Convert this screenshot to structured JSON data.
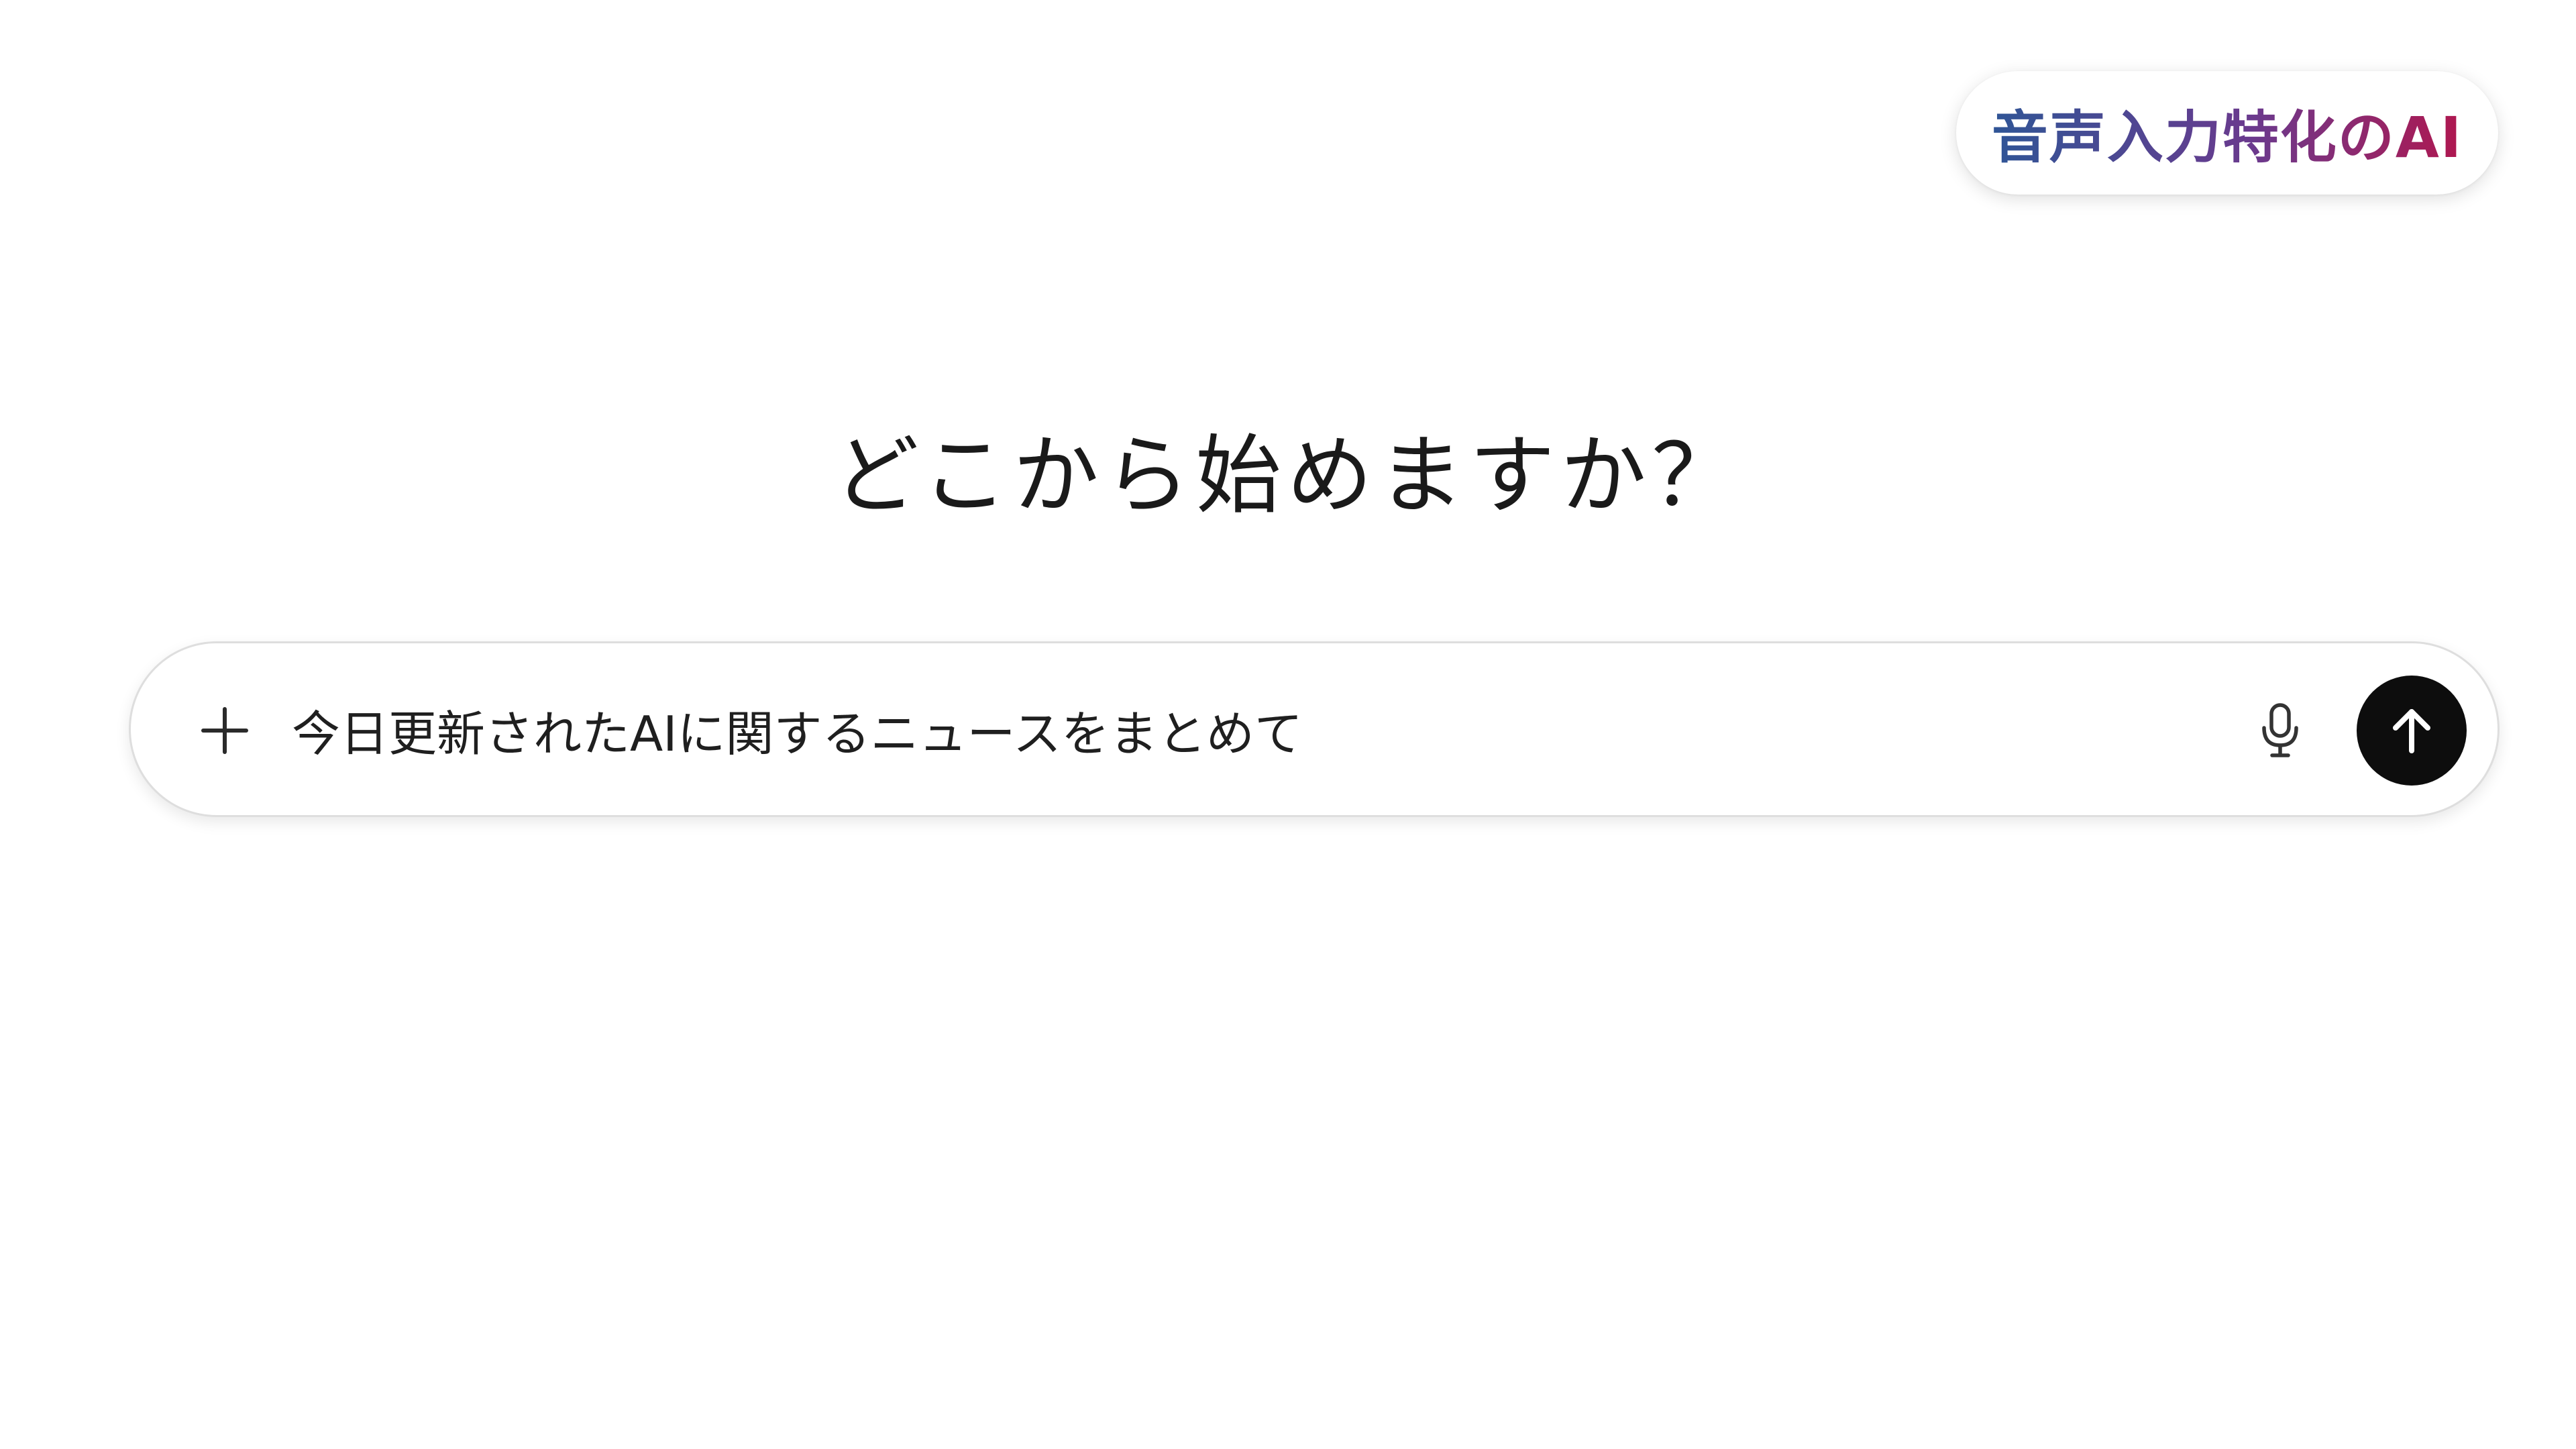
{
  "badge": {
    "text": "音声入力特化のAI",
    "gradient_start": "#2f5596",
    "gradient_end": "#b0174f"
  },
  "heading": {
    "text": "どこから始めますか？"
  },
  "composer": {
    "add_icon": "plus-icon",
    "input_value": "今日更新されたAIに関するニュースをまとめて",
    "mic_icon": "microphone-icon",
    "send_icon": "arrow-up-icon",
    "send_button_color": "#0d0d0d"
  }
}
